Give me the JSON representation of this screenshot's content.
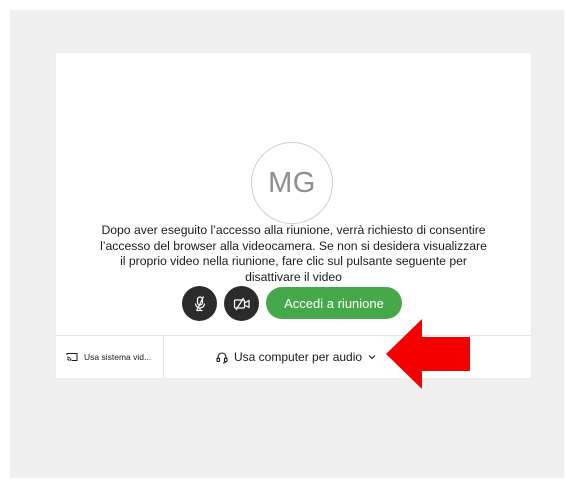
{
  "avatar": {
    "initials": "MG"
  },
  "prompt": {
    "message": "Dopo aver eseguito l’accesso alla riunione, verrà richiesto di consentire l’accesso del browser alla videocamera. Se non si desidera visualizzare il proprio video nella riunione, fare clic sul pulsante seguente per disattivare il video"
  },
  "controls": {
    "mic_icon": "microphone-muted-icon",
    "camera_icon": "video-camera-muted-icon",
    "join_label": "Accedi a riunione",
    "join_color": "#45a84b",
    "round_button_color": "#2b2b2b"
  },
  "bottom_bar": {
    "video_system_label": "Usa sistema vid...",
    "video_system_icon": "cast-icon",
    "audio_label": "Usa computer per audio",
    "audio_icon": "headset-icon",
    "chevron_icon": "chevron-down-icon"
  },
  "annotation": {
    "arrow_icon": "red-arrow-left-icon",
    "arrow_color": "#f40000"
  }
}
